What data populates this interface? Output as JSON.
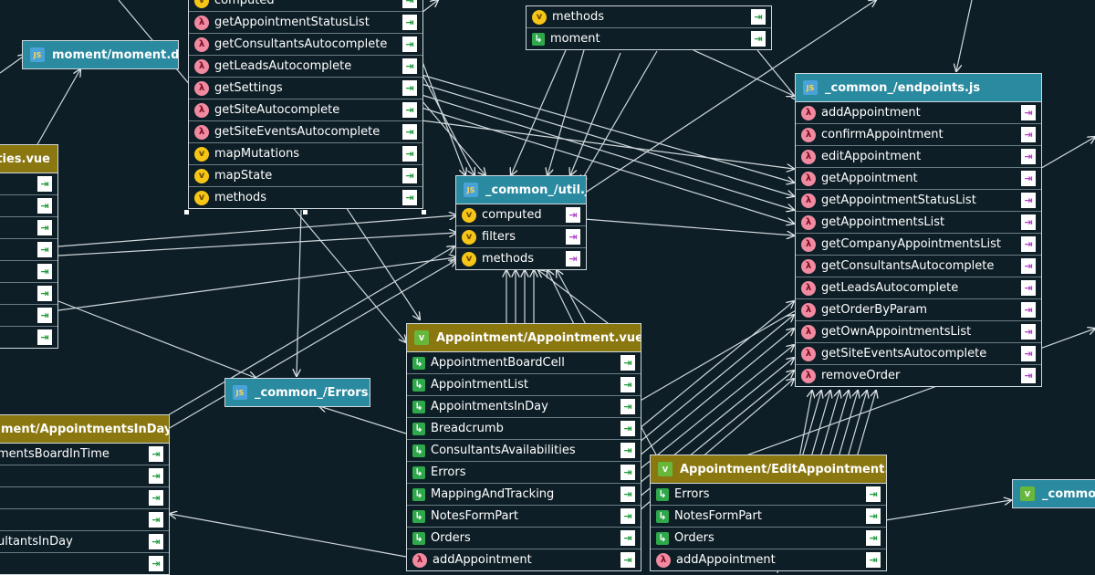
{
  "nodes": {
    "moment_d_ts": {
      "title": "moment/moment.d.ts"
    },
    "util_js": {
      "title": "_common_/util.js",
      "rows": [
        {
          "label": "computed",
          "kind": "v"
        },
        {
          "label": "filters",
          "kind": "v"
        },
        {
          "label": "methods",
          "kind": "v"
        }
      ]
    },
    "errors_js": {
      "title": "_common_/Errors.js"
    },
    "endpoints_js": {
      "title": "_common_/endpoints.js",
      "rows": [
        {
          "label": "addAppointment"
        },
        {
          "label": "confirmAppointment"
        },
        {
          "label": "editAppointment"
        },
        {
          "label": "getAppointment"
        },
        {
          "label": "getAppointmentStatusList"
        },
        {
          "label": "getAppointmentsList"
        },
        {
          "label": "getCompanyAppointmentsList"
        },
        {
          "label": "getConsultantsAutocomplete"
        },
        {
          "label": "getLeadsAutocomplete"
        },
        {
          "label": "getOrderByParam"
        },
        {
          "label": "getOwnAppointmentsList"
        },
        {
          "label": "getSiteEventsAutocomplete"
        },
        {
          "label": "removeOrder"
        }
      ]
    },
    "top_component": {
      "rows": [
        {
          "label": "computed",
          "kind": "v"
        },
        {
          "label": "getAppointmentStatusList",
          "kind": "fn"
        },
        {
          "label": "getConsultantsAutocomplete",
          "kind": "fn"
        },
        {
          "label": "getLeadsAutocomplete",
          "kind": "fn"
        },
        {
          "label": "getSettings",
          "kind": "fn"
        },
        {
          "label": "getSiteAutocomplete",
          "kind": "fn"
        },
        {
          "label": "getSiteEventsAutocomplete",
          "kind": "fn"
        },
        {
          "label": "mapMutations",
          "kind": "v"
        },
        {
          "label": "mapState",
          "kind": "v"
        },
        {
          "label": "methods",
          "kind": "v"
        }
      ]
    },
    "top_right_component": {
      "rows": [
        {
          "label": "methods",
          "kind": "v"
        },
        {
          "label": "moment",
          "kind": "ar"
        }
      ]
    },
    "availabilities_vue": {
      "title": "ilities.vue",
      "rows": [
        "",
        "",
        "",
        "",
        "",
        "",
        "",
        ""
      ]
    },
    "appointments_in_day_vue": {
      "title": "ment/AppointmentsInDay.vue",
      "rows": [
        {
          "label": "mentsBoardInTime"
        },
        {
          "label": ""
        },
        {
          "label": ""
        },
        {
          "label": ""
        },
        {
          "label": "ultantsInDay"
        },
        {
          "label": ""
        }
      ]
    },
    "appointment_vue": {
      "title": "Appointment/Appointment.vue",
      "rows": [
        {
          "label": "AppointmentBoardCell",
          "kind": "ar"
        },
        {
          "label": "AppointmentList",
          "kind": "ar"
        },
        {
          "label": "AppointmentsInDay",
          "kind": "ar"
        },
        {
          "label": "Breadcrumb",
          "kind": "ar"
        },
        {
          "label": "ConsultantsAvailabilities",
          "kind": "ar"
        },
        {
          "label": "Errors",
          "kind": "ar"
        },
        {
          "label": "MappingAndTracking",
          "kind": "ar"
        },
        {
          "label": "NotesFormPart",
          "kind": "ar"
        },
        {
          "label": "Orders",
          "kind": "ar"
        },
        {
          "label": "addAppointment",
          "kind": "fn"
        }
      ]
    },
    "edit_appointment_vue": {
      "title": "Appointment/EditAppointment.vue",
      "rows": [
        {
          "label": "Errors",
          "kind": "ar"
        },
        {
          "label": "NotesFormPart",
          "kind": "ar"
        },
        {
          "label": "Orders",
          "kind": "ar"
        },
        {
          "label": "addAppointment",
          "kind": "fn"
        }
      ]
    },
    "common_right": {
      "title": "_common_"
    }
  },
  "icons": {
    "value_badge": "v-badge-icon",
    "function_badge": "lambda-icon",
    "import_arrow": "import-arrow-icon",
    "export_arrow": "export-arrow-icon",
    "file_js": "js-file-icon",
    "file_vue": "vue-file-icon"
  },
  "colors": {
    "background": "#0e1e26",
    "teal_header": "#2a8aa0",
    "gold_header": "#8a7710",
    "wire": "#cfd8dc"
  }
}
